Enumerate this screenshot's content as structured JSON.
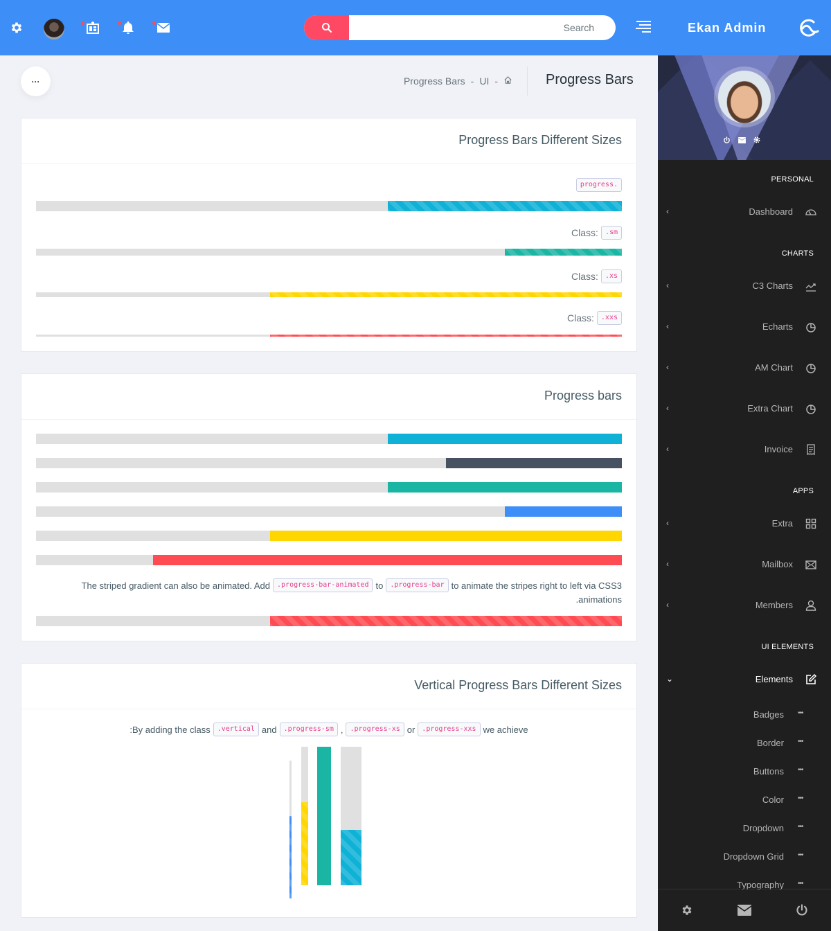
{
  "header": {
    "icons": [
      "gear-icon",
      "avatar",
      "dashboard-icon",
      "bell-icon",
      "mail-icon"
    ],
    "search_placeholder": "Search",
    "brand": "Ekan Admin",
    "colors": {
      "bar": "#3e8ef7",
      "search_button": "#ff4863",
      "notification_dot": "#ff4c52"
    }
  },
  "page": {
    "more_button": "···",
    "breadcrumb": [
      "Progress Bars",
      "UI"
    ],
    "breadcrumb_sep": "-",
    "title": "Progress Bars"
  },
  "sidebar": {
    "profile_links": [
      "power-icon",
      "mail-icon",
      "gear-icon"
    ],
    "sections": [
      {
        "header": "PERSONAL",
        "items": [
          {
            "label": "Dashboard",
            "icon": "dashboard-gauge-icon"
          }
        ]
      },
      {
        "header": "CHARTS",
        "items": [
          {
            "label": "C3 Charts",
            "icon": "line-chart-icon"
          },
          {
            "label": "Echarts",
            "icon": "pie-chart-icon"
          },
          {
            "label": "AM Chart",
            "icon": "pie-chart-icon"
          },
          {
            "label": "Extra Chart",
            "icon": "pie-chart-icon"
          },
          {
            "label": "Invoice",
            "icon": "invoice-icon"
          }
        ]
      },
      {
        "header": "APPS",
        "items": [
          {
            "label": "Extra",
            "icon": "grid-icon"
          },
          {
            "label": "Mailbox",
            "icon": "envelope-icon"
          },
          {
            "label": "Members",
            "icon": "user-icon"
          }
        ]
      },
      {
        "header": "UI ELEMENTS",
        "items": [
          {
            "label": "Elements",
            "icon": "edit-icon",
            "expanded": true
          }
        ]
      }
    ],
    "sub_items": [
      "Badges",
      "Border",
      "Buttons",
      "Color",
      "Dropdown",
      "Dropdown Grid",
      "Typography"
    ],
    "sub_item_dots": "•••",
    "footer": [
      "gear-icon",
      "envelope-icon",
      "power-icon"
    ]
  },
  "boxes": {
    "sizes": {
      "title": "Progress Bars Different Sizes",
      "bars": [
        {
          "prefix": "",
          "code": "progress.",
          "value": 40,
          "color": "#0fb1d6",
          "striped": true,
          "size": "default"
        },
        {
          "prefix": "Class:",
          "code": ".sm",
          "value": 20,
          "color": "#1ab5a3",
          "striped": true,
          "size": "sm"
        },
        {
          "prefix": "Class:",
          "code": ".xs",
          "value": 60,
          "color": "#ffd600",
          "striped": true,
          "size": "xs"
        },
        {
          "prefix": "Class:",
          "code": ".xxs",
          "value": 60,
          "color": "#ff4c52",
          "striped": true,
          "size": "xxs"
        }
      ]
    },
    "basic": {
      "title": "Progress bars",
      "bars": [
        {
          "value": 40,
          "color": "#0fb1d6"
        },
        {
          "value": 30,
          "color": "#465161"
        },
        {
          "value": 40,
          "color": "#1ab5a3"
        },
        {
          "value": 20,
          "color": "#3e8ef7"
        },
        {
          "value": 60,
          "color": "#ffd600"
        },
        {
          "value": 80,
          "color": "#ff4c52"
        }
      ],
      "note": {
        "before": "The striped gradient can also be animated. Add",
        "code1": ".progress-bar-animated",
        "mid": "to",
        "code2": ".progress-bar",
        "after": "to animate the stripes right to left via CSS3",
        "line2": ".animations"
      },
      "animated_bar": {
        "value": 60,
        "color": "#ff4c52"
      }
    },
    "vertical": {
      "title": "Vertical Progress Bars Different Sizes",
      "note": {
        "before": ":By adding the class",
        "code1": ".vertical",
        "w1": "and",
        "code2": ".progress-sm",
        "w2": ",",
        "code3": ".progress-xs",
        "w3": "or",
        "code4": ".progress-xxs",
        "after": "we achieve"
      },
      "bars": [
        {
          "size": "xxs",
          "value": 60,
          "color": "#3e8ef7",
          "striped": true
        },
        {
          "size": "xs",
          "value": 60,
          "color": "#ffd600",
          "striped": true
        },
        {
          "size": "sm",
          "value": 100,
          "color": "#1ab5a3",
          "striped": false
        },
        {
          "size": "default",
          "value": 40,
          "color": "#0fb1d6",
          "striped": true
        }
      ]
    }
  }
}
